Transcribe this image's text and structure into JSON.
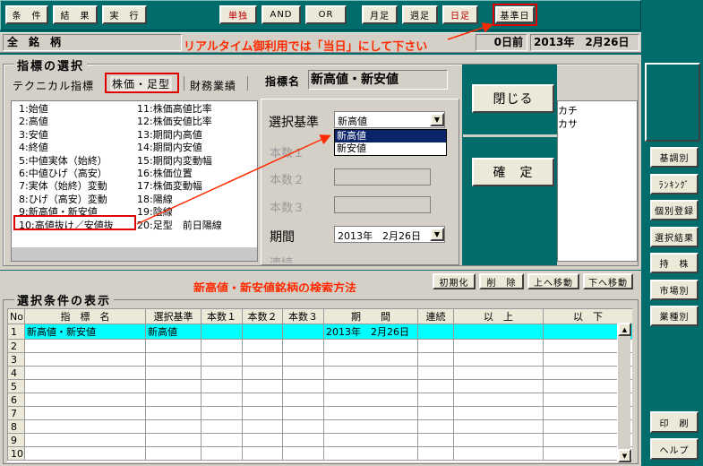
{
  "toolbar": {
    "condition": "条　件",
    "result": "結　果",
    "execute": "実　行",
    "single": "単独",
    "and": "AND",
    "or": "OR",
    "monthly": "月足",
    "weekly": "週足",
    "daily": "日足",
    "base_date": "基準日"
  },
  "scope": {
    "all_stocks": "全　銘　柄",
    "days_before": "0日前",
    "date": "2013年　2月26日"
  },
  "annotations": {
    "realtime_note": "リアルタイム御利用では「当日」にして下さい",
    "method_note": "新高値・新安値銘柄の検索方法"
  },
  "indicator": {
    "section_title": "指標の選択",
    "tabs": [
      "テクニカル指標",
      "株価・足型",
      "財務業績"
    ],
    "name_label": "指標名",
    "name_value": "新高値・新安値",
    "items_left": [
      "1:始値",
      "2:高値",
      "3:安値",
      "4:終値",
      "5:中値実体（始終）",
      "6:中値ひげ（高安）",
      "7:実体（始終）変動",
      "8:ひげ（高安）変動",
      "9:新高値・新安値",
      "10:高値抜け／安値抜"
    ],
    "items_right": [
      "11:株価高値比率",
      "12:株価安値比率",
      "13:期間内高値",
      "14:期間内安値",
      "15:期間内変動幅",
      "16:株価位置",
      "17:株価変動幅",
      "18:陽線",
      "19:陰線",
      "20:足型　前日陽線"
    ]
  },
  "criteria": {
    "basis_label": "選択基準",
    "basis_value": "新高値",
    "options": [
      "新高値",
      "新安値"
    ],
    "count1": "本数１",
    "count2": "本数２",
    "count3": "本数３",
    "period_label": "期間",
    "period_value": "2013年　2月26日",
    "continuous_label": "連続"
  },
  "side_panel": {
    "close": "閉じる",
    "confirm": "確　定",
    "peek1": "カチ",
    "peek2": "カサ"
  },
  "actions": {
    "initialize": "初期化",
    "delete": "削　除",
    "move_up": "上へ移動",
    "move_down": "下へ移動"
  },
  "conditions": {
    "section_title": "選択条件の表示",
    "headers": [
      "No",
      "指　標　名",
      "選択基準",
      "本数１",
      "本数２",
      "本数３",
      "期　　間",
      "連続",
      "以　上",
      "以　下"
    ],
    "rows": [
      [
        "1",
        "新高値・新安値",
        "新高値",
        "",
        "",
        "",
        "2013年　2月26日",
        "",
        "",
        ""
      ],
      [
        "2",
        "",
        "",
        "",
        "",
        "",
        "",
        "",
        "",
        ""
      ],
      [
        "3",
        "",
        "",
        "",
        "",
        "",
        "",
        "",
        "",
        ""
      ],
      [
        "4",
        "",
        "",
        "",
        "",
        "",
        "",
        "",
        "",
        ""
      ],
      [
        "5",
        "",
        "",
        "",
        "",
        "",
        "",
        "",
        "",
        ""
      ],
      [
        "6",
        "",
        "",
        "",
        "",
        "",
        "",
        "",
        "",
        ""
      ],
      [
        "7",
        "",
        "",
        "",
        "",
        "",
        "",
        "",
        "",
        ""
      ],
      [
        "8",
        "",
        "",
        "",
        "",
        "",
        "",
        "",
        "",
        ""
      ],
      [
        "9",
        "",
        "",
        "",
        "",
        "",
        "",
        "",
        "",
        ""
      ],
      [
        "10",
        "",
        "",
        "",
        "",
        "",
        "",
        "",
        "",
        ""
      ]
    ]
  },
  "right_menu": [
    "基調別",
    "ﾗﾝｷﾝｸﾞ",
    "個別登録",
    "選択結果",
    "持　株",
    "市場別",
    "業種別"
  ],
  "bottom_menu": {
    "print": "印　刷",
    "help": "ヘルプ"
  }
}
